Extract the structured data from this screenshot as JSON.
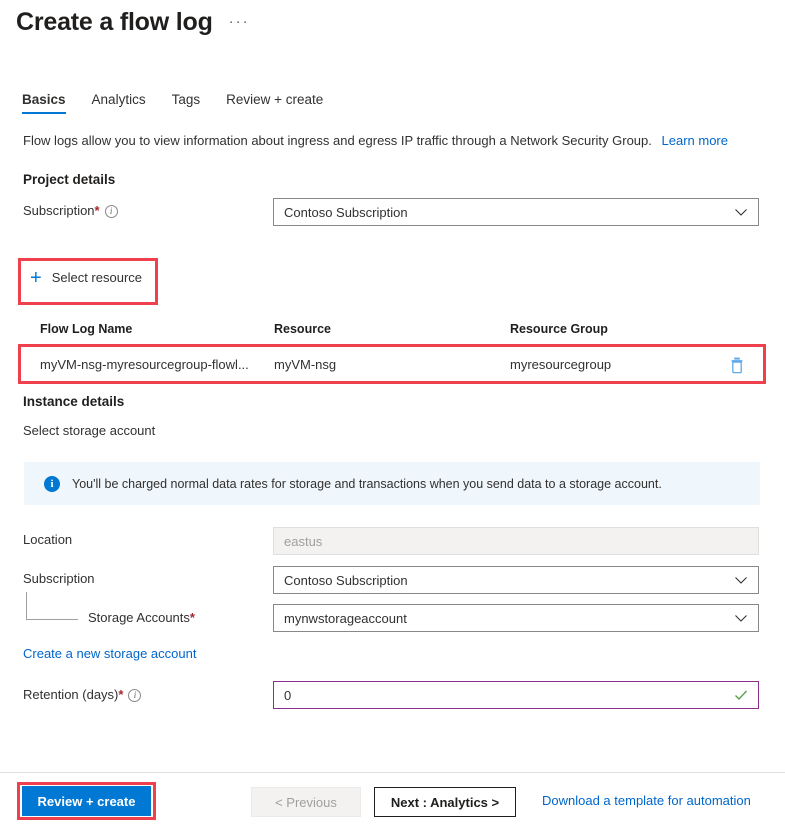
{
  "header": {
    "title": "Create a flow log",
    "more_label": "···"
  },
  "tabs": [
    {
      "label": "Basics",
      "active": true
    },
    {
      "label": "Analytics",
      "active": false
    },
    {
      "label": "Tags",
      "active": false
    },
    {
      "label": "Review + create",
      "active": false
    }
  ],
  "description": {
    "text": "Flow logs allow you to view information about ingress and egress IP traffic through a Network Security Group.",
    "link_label": "Learn more"
  },
  "project_details": {
    "heading": "Project details",
    "subscription": {
      "label": "Subscription",
      "required": "*",
      "info": "ℹ",
      "value": "Contoso Subscription"
    }
  },
  "select_resource": {
    "label": "Select resource",
    "icon": "plus-icon"
  },
  "resource_table": {
    "columns": [
      "Flow Log Name",
      "Resource",
      "Resource Group"
    ],
    "rows": [
      {
        "flow_log_name": "myVM-nsg-myresourcegroup-flowl...",
        "resource": "myVM-nsg",
        "resource_group": "myresourcegroup",
        "delete_icon": "trash-icon"
      }
    ]
  },
  "instance_details": {
    "heading": "Instance details",
    "subheading": "Select storage account",
    "banner": {
      "icon": "info-icon",
      "text": "You'll be charged normal data rates for storage and transactions when you send data to a storage account."
    },
    "location": {
      "label": "Location",
      "value": "eastus",
      "disabled": true
    },
    "subscription": {
      "label": "Subscription",
      "value": "Contoso Subscription"
    },
    "storage_accounts": {
      "label": "Storage Accounts",
      "required": "*",
      "value": "mynwstorageaccount"
    },
    "create_storage_link": "Create a new storage account",
    "retention": {
      "label": "Retention (days)",
      "required": "*",
      "info": "ℹ",
      "value": "0",
      "validated": true
    }
  },
  "footer": {
    "review_create": "Review + create",
    "previous": "< Previous",
    "next": "Next : Analytics >",
    "download_template": "Download a template for automation"
  },
  "colors": {
    "accent": "#0078d4",
    "highlight": "#f0404e",
    "link": "#0066cc",
    "required": "#a4262c",
    "banner_bg": "#eff6fc",
    "focus_border": "#8c2f8c",
    "valid_check": "#5a9e4b"
  }
}
